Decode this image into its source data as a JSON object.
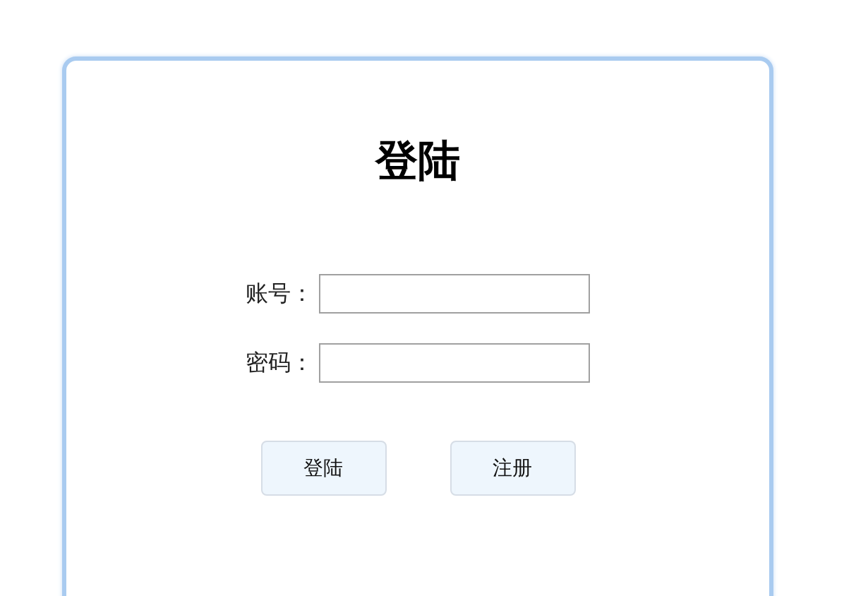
{
  "title": "登陆",
  "fields": [
    {
      "label": "账号："
    },
    {
      "label": "密码："
    }
  ],
  "buttons": [
    "登陆",
    "注册"
  ]
}
